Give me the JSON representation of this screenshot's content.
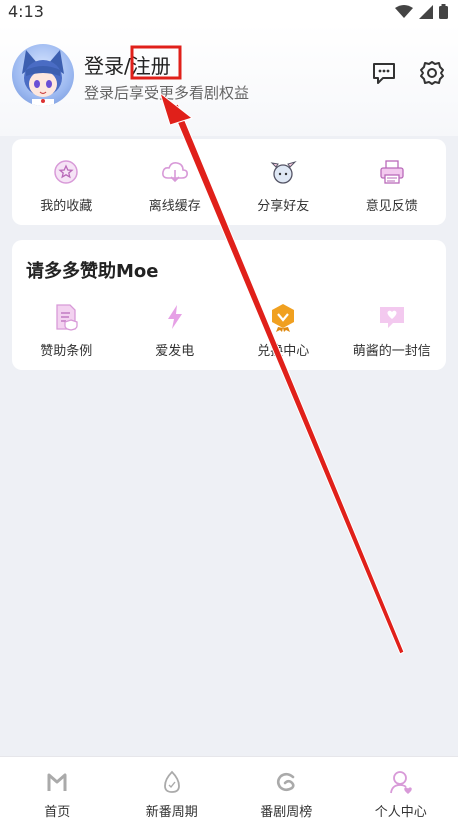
{
  "status_bar": {
    "time": "4:13"
  },
  "header": {
    "login_title": "登录/注册",
    "login_subtitle": "登录后享受更多看剧权益"
  },
  "quick_actions": [
    {
      "label": "我的收藏",
      "icon": "favorites-star-icon"
    },
    {
      "label": "离线缓存",
      "icon": "cloud-download-icon"
    },
    {
      "label": "分享好友",
      "icon": "share-friends-icon"
    },
    {
      "label": "意见反馈",
      "icon": "feedback-printer-icon"
    }
  ],
  "sponsor": {
    "title": "请多多赞助Moe",
    "items": [
      {
        "label": "赞助条例",
        "icon": "sponsor-terms-icon"
      },
      {
        "label": "爱发电",
        "icon": "lightning-icon"
      },
      {
        "label": "兑换中心",
        "icon": "redeem-badge-icon"
      },
      {
        "label": "萌酱的一封信",
        "icon": "letter-heart-icon"
      }
    ]
  },
  "bottom_nav": [
    {
      "label": "首页",
      "icon": "home-m-icon",
      "active": false
    },
    {
      "label": "新番周期",
      "icon": "egg-icon",
      "active": false
    },
    {
      "label": "番剧周榜",
      "icon": "swirl-icon",
      "active": false
    },
    {
      "label": "个人中心",
      "icon": "profile-heart-icon",
      "active": true
    }
  ],
  "colors": {
    "accent_pink": "#d89ad8",
    "annotation_red": "#e0201a",
    "badge_orange": "#f0a020",
    "page_bg": "#eef0f5"
  }
}
